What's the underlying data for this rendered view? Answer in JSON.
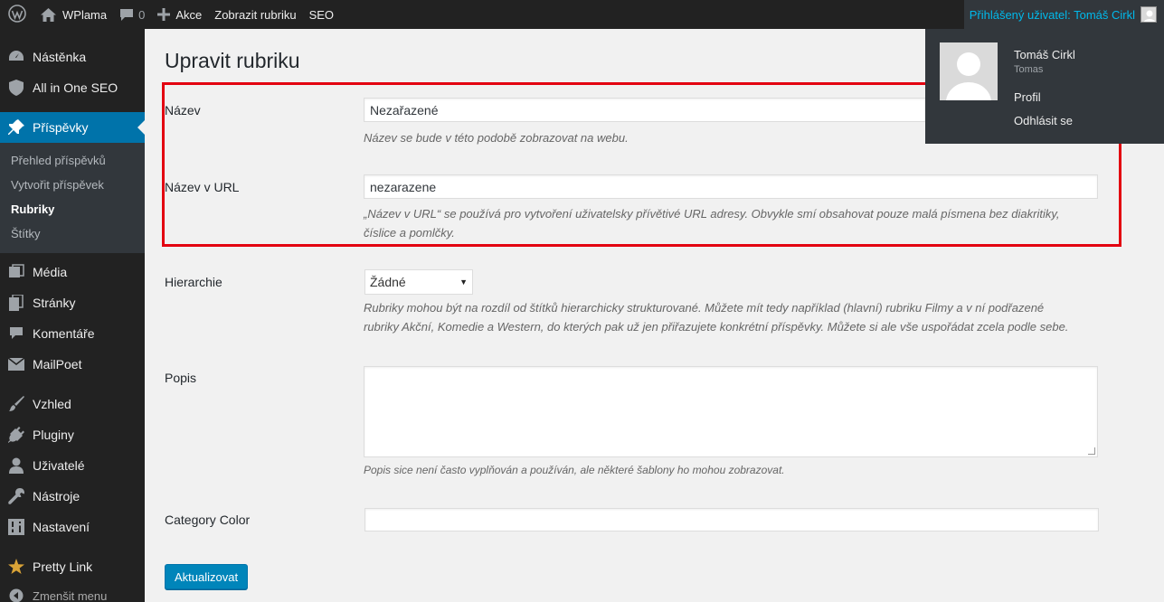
{
  "adminbar": {
    "site_name": "WPlama",
    "comments_count": "0",
    "new_label": "Akce",
    "view_label": "Zobrazit rubriku",
    "seo_label": "SEO",
    "howdy": "Přihlášený uživatel: Tomáš Cirkl"
  },
  "account": {
    "display_name": "Tomáš Cirkl",
    "username": "Tomas",
    "profile": "Profil",
    "logout": "Odhlásit se"
  },
  "sidebar": {
    "items": [
      {
        "label": "Nástěnka",
        "icon": "dashboard-icon"
      },
      {
        "label": "All in One SEO",
        "icon": "shield-icon"
      },
      {
        "label": "Příspěvky",
        "icon": "pin-icon"
      },
      {
        "label": "Média",
        "icon": "media-icon"
      },
      {
        "label": "Stránky",
        "icon": "pages-icon"
      },
      {
        "label": "Komentáře",
        "icon": "comment-icon"
      },
      {
        "label": "MailPoet",
        "icon": "mail-icon"
      },
      {
        "label": "Vzhled",
        "icon": "brush-icon"
      },
      {
        "label": "Pluginy",
        "icon": "plugin-icon"
      },
      {
        "label": "Uživatelé",
        "icon": "user-icon"
      },
      {
        "label": "Nástroje",
        "icon": "wrench-icon"
      },
      {
        "label": "Nastavení",
        "icon": "settings-icon"
      },
      {
        "label": "Pretty Link",
        "icon": "star-icon"
      }
    ],
    "submenu": [
      "Přehled příspěvků",
      "Vytvořit příspěvek",
      "Rubriky",
      "Štítky"
    ],
    "collapse": "Zmenšit menu"
  },
  "form": {
    "title": "Upravit rubriku",
    "name_label": "Název",
    "name_value": "Nezařazené",
    "name_desc": "Název se bude v této podobě zobrazovat na webu.",
    "slug_label": "Název v URL",
    "slug_value": "nezarazene",
    "slug_desc_1": "„Název v URL“ se používá pro vytvoření uživatelsky přívětivé URL adresy. Obvykle smí obsahovat pouze malá písmena bez diakritiky,",
    "slug_desc_2": "číslice a pomlčky.",
    "parent_label": "Hierarchie",
    "parent_value": "Žádné",
    "parent_desc_1": "Rubriky mohou být na rozdíl od štítků hierarchicky strukturované. Můžete mít tedy například (hlavní) rubriku Filmy a v ní podřazené",
    "parent_desc_2": "rubriky Akční, Komedie a Western, do kterých pak už jen přiřazujete konkrétní příspěvky. Můžete si ale vše uspořádat zcela podle sebe.",
    "desc_label": "Popis",
    "desc_help": "Popis sice není často vyplňován a používán, ale některé šablony ho mohou zobrazovat.",
    "color_label": "Category Color",
    "submit": "Aktualizovat"
  },
  "colors": {
    "accent": "#0073aa",
    "highlight": "#e30010",
    "adminbar": "#222222"
  }
}
